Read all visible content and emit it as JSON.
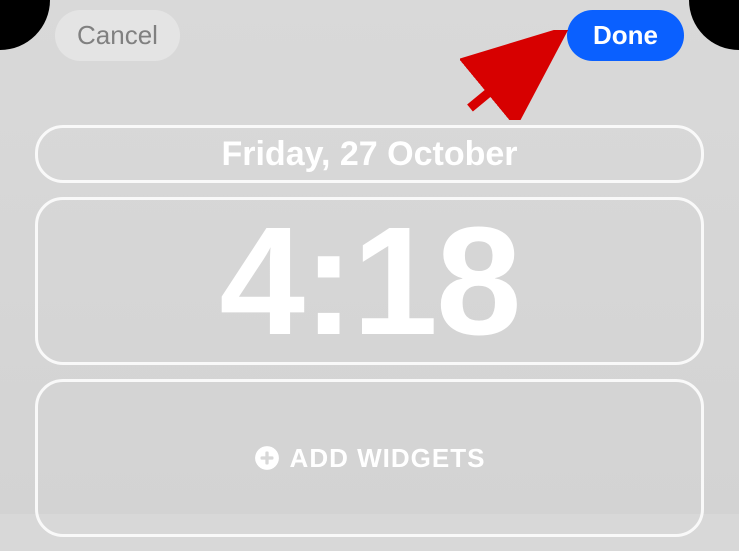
{
  "topbar": {
    "cancel_label": "Cancel",
    "done_label": "Done"
  },
  "lockscreen": {
    "date": "Friday, 27 October",
    "time": "4:18",
    "add_widgets_label": "ADD WIDGETS"
  },
  "colors": {
    "done_bg": "#0a60ff",
    "arrow": "#d70000"
  }
}
